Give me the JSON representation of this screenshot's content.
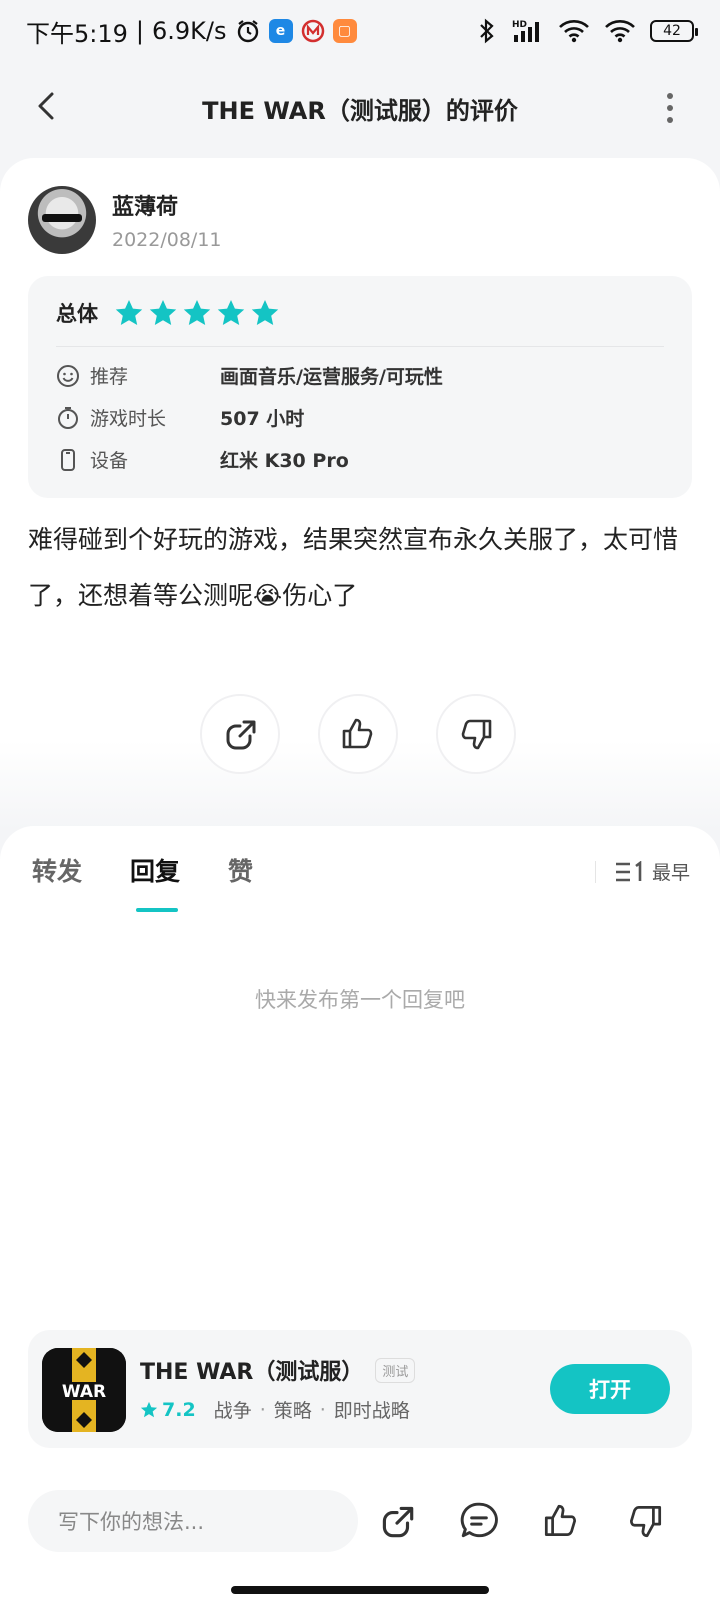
{
  "status_bar": {
    "time": "下午5:19",
    "speed": "6.9K/s",
    "battery": "42",
    "network_hd": "HD"
  },
  "nav": {
    "title": "THE WAR（测试服）的评价"
  },
  "review": {
    "user_name": "蓝薄荷",
    "date": "2022/08/11",
    "overall_label": "总体",
    "stars": 5,
    "recommend_label": "推荐",
    "recommend_value": "画面音乐/运营服务/可玩性",
    "playtime_label": "游戏时长",
    "playtime_value": "507 小时",
    "device_label": "设备",
    "device_value": "红米 K30 Pro",
    "text": "难得碰到个好玩的游戏，结果突然宣布永久关服了，太可惜了，还想着等公测呢😭伤心了"
  },
  "tabs": {
    "items": [
      "转发",
      "回复",
      "赞"
    ],
    "active": "回复",
    "sort_label": "最早"
  },
  "empty_text": "快来发布第一个回复吧",
  "game": {
    "name": "THE WAR（测试服）",
    "badge": "测试",
    "score": "7.2",
    "tags": [
      "战争",
      "策略",
      "即时战略"
    ],
    "open_label": "打开",
    "icon_text": "WAR"
  },
  "bottom": {
    "input_placeholder": "写下你的想法..."
  },
  "colors": {
    "accent": "#14c4c4",
    "background": "#f4f5f7"
  }
}
